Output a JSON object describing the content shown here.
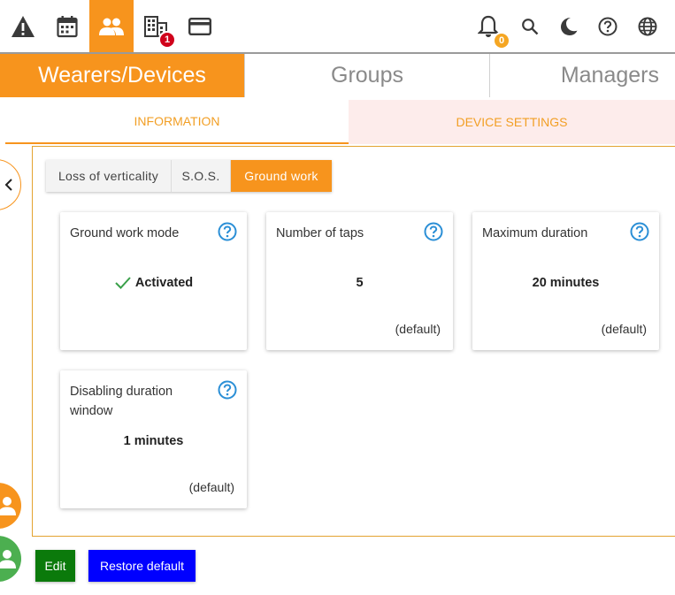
{
  "topbar": {
    "icons": [
      "warning-icon",
      "calendar-icon",
      "people-icon",
      "building-icon",
      "card-icon"
    ],
    "right_icons": [
      "bell-icon",
      "search-icon",
      "moon-icon",
      "help-icon",
      "globe-icon"
    ],
    "building_badge": "1",
    "notifications_badge": "0"
  },
  "main_tabs": {
    "wearers": "Wearers/Devices",
    "groups": "Groups",
    "managers": "Managers"
  },
  "sub_tabs": {
    "information": "INFORMATION",
    "device_settings": "DEVICE SETTINGS"
  },
  "mode_tabs": {
    "loss_of_verticality": "Loss of verticality",
    "sos": "S.O.S.",
    "ground_work": "Ground work"
  },
  "cards": {
    "ground_work_mode": {
      "title": "Ground work mode",
      "value": "Activated"
    },
    "number_of_taps": {
      "title": "Number of taps",
      "value": "5",
      "note": "(default)"
    },
    "maximum_duration": {
      "title": "Maximum duration",
      "value": "20 minutes",
      "note": "(default)"
    },
    "disabling_duration": {
      "title": "Disabling duration window",
      "value": "1 minutes",
      "note": "(default)"
    }
  },
  "buttons": {
    "edit": "Edit",
    "restore": "Restore default"
  },
  "colors": {
    "accent": "#f7941d",
    "badge_red": "#d0021b",
    "badge_orange": "#f5a623",
    "edit_button": "#0b7a0b",
    "restore_button": "#0000ff",
    "help_blue": "#2b8fd6",
    "check_green": "#3aa04a"
  }
}
